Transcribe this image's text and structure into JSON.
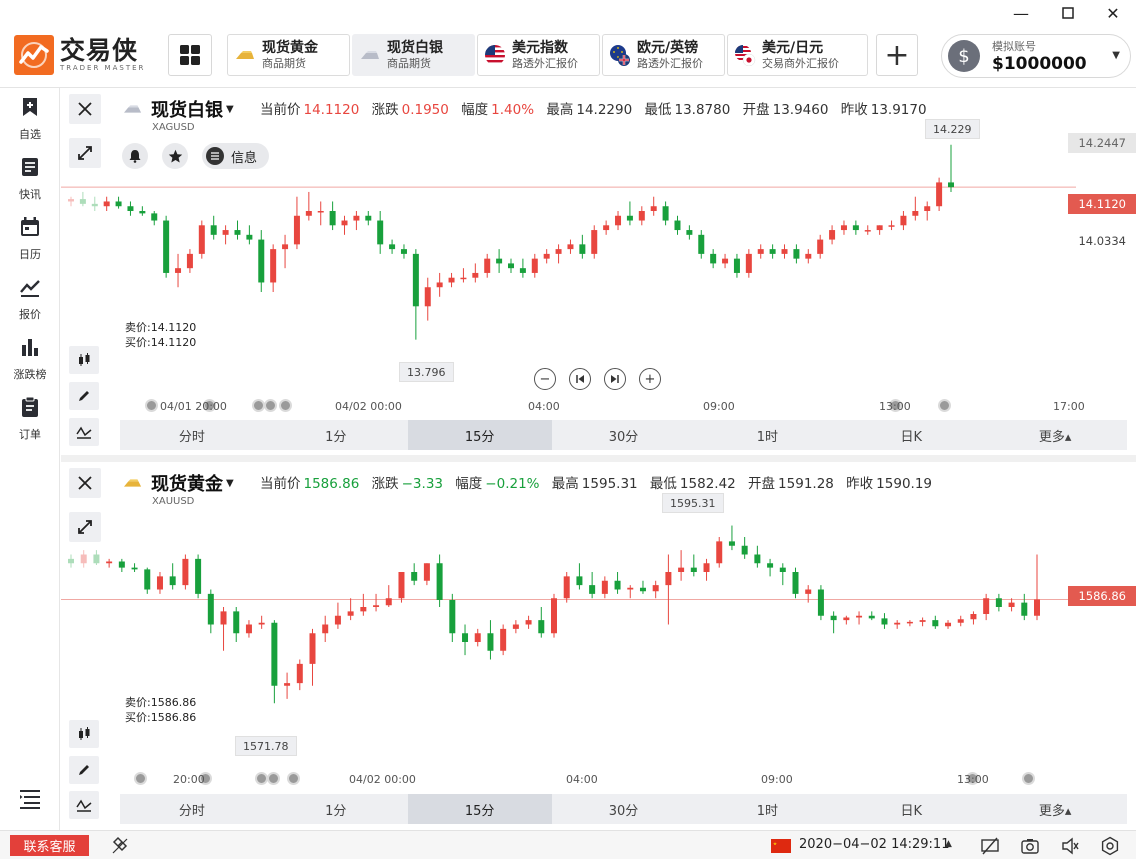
{
  "app": {
    "logo_cn": "交易侠",
    "logo_en": "TRADER MASTER",
    "colors": {
      "accent": "#f26b21",
      "up": "#e8463f",
      "down": "#18a03c",
      "tab_active": "#d8dbe1"
    }
  },
  "quote_tabs": [
    {
      "name": "现货黄金",
      "sub": "商品期货",
      "icon": "gold-bar-icon"
    },
    {
      "name": "现货白银",
      "sub": "商品期货",
      "icon": "silver-bar-icon"
    },
    {
      "name": "美元指数",
      "sub": "路透外汇报价",
      "icon": "us-flag-icon"
    },
    {
      "name": "欧元/英镑",
      "sub": "路透外汇报价",
      "icon": "eu-uk-flag-icon"
    },
    {
      "name": "美元/日元",
      "sub": "交易商外汇报价",
      "icon": "us-jp-flag-icon"
    }
  ],
  "account": {
    "label": "模拟账号",
    "balance": "$1000000"
  },
  "sidebar": [
    {
      "label": "自选",
      "icon": "bookmark-plus-icon"
    },
    {
      "label": "快讯",
      "icon": "news-icon"
    },
    {
      "label": "日历",
      "icon": "calendar-icon"
    },
    {
      "label": "报价",
      "icon": "line-chart-icon"
    },
    {
      "label": "涨跌榜",
      "icon": "bar-chart-icon"
    },
    {
      "label": "订单",
      "icon": "clipboard-icon"
    }
  ],
  "timeframes": [
    "分时",
    "1分",
    "15分",
    "30分",
    "1时",
    "日K",
    "更多▴"
  ],
  "panels": {
    "silver": {
      "name": "现货白银",
      "code": "XAGUSD",
      "stats": {
        "cur_label": "当前价",
        "cur": "14.1120",
        "chg_label": "涨跌",
        "chg": "0.1950",
        "pct_label": "幅度",
        "pct": "1.40%",
        "high_label": "最高",
        "high": "14.2290",
        "low_label": "最低",
        "low": "13.8780",
        "open_label": "开盘",
        "open": "13.9460",
        "prev_label": "昨收",
        "prev": "13.9170"
      },
      "info_label": "信息",
      "sell": "卖价:14.1120",
      "buy": "买价:14.1120",
      "price_tag": "14.1120",
      "side_top": "14.2447",
      "side_mid": "14.0334",
      "hi_callout": "14.229",
      "lo_callout": "13.796",
      "time_axis": [
        "04/01 20:00",
        "04/02 00:00",
        "04:00",
        "09:00",
        "13:00",
        "17:00"
      ]
    },
    "gold": {
      "name": "现货黄金",
      "code": "XAUUSD",
      "stats": {
        "cur_label": "当前价",
        "cur": "1586.86",
        "chg_label": "涨跌",
        "chg": "−3.33",
        "pct_label": "幅度",
        "pct": "−0.21%",
        "high_label": "最高",
        "high": "1595.31",
        "low_label": "最低",
        "low": "1582.42",
        "open_label": "开盘",
        "open": "1591.28",
        "prev_label": "昨收",
        "prev": "1590.19"
      },
      "sell": "卖价:1586.86",
      "buy": "买价:1586.86",
      "price_tag": "1586.86",
      "hi_callout": "1595.31",
      "lo_callout": "1571.78",
      "time_axis": [
        "20:00",
        "04/02 00:00",
        "04:00",
        "09:00",
        "13:00"
      ]
    }
  },
  "status": {
    "customer_service": "联系客服",
    "datetime": "2020−04−02 14:29:11"
  },
  "chart_data": [
    {
      "type": "candlestick",
      "title": "现货白银",
      "ylim": [
        13.75,
        14.26
      ],
      "candles": [
        [
          14.11,
          14.12,
          14.1,
          14.115
        ],
        [
          14.115,
          14.13,
          14.1,
          14.105
        ],
        [
          14.105,
          14.12,
          14.09,
          14.1
        ],
        [
          14.1,
          14.12,
          14.09,
          14.11
        ],
        [
          14.11,
          14.12,
          14.095,
          14.1
        ],
        [
          14.1,
          14.11,
          14.08,
          14.09
        ],
        [
          14.09,
          14.1,
          14.08,
          14.085
        ],
        [
          14.085,
          14.09,
          14.06,
          14.07
        ],
        [
          14.07,
          14.08,
          13.95,
          13.96
        ],
        [
          13.96,
          14.0,
          13.93,
          13.97
        ],
        [
          13.97,
          14.01,
          13.96,
          14.0
        ],
        [
          14.0,
          14.07,
          13.99,
          14.06
        ],
        [
          14.06,
          14.08,
          14.03,
          14.04
        ],
        [
          14.04,
          14.06,
          14.02,
          14.05
        ],
        [
          14.05,
          14.07,
          14.03,
          14.04
        ],
        [
          14.04,
          14.06,
          14.02,
          14.03
        ],
        [
          14.03,
          14.05,
          13.92,
          13.94
        ],
        [
          13.94,
          14.02,
          13.92,
          14.01
        ],
        [
          14.01,
          14.04,
          13.97,
          14.02
        ],
        [
          14.02,
          14.12,
          14.01,
          14.08
        ],
        [
          14.08,
          14.13,
          14.07,
          14.09
        ],
        [
          14.09,
          14.11,
          14.06,
          14.09
        ],
        [
          14.09,
          14.11,
          14.05,
          14.06
        ],
        [
          14.06,
          14.08,
          14.04,
          14.07
        ],
        [
          14.07,
          14.09,
          14.05,
          14.08
        ],
        [
          14.08,
          14.09,
          14.06,
          14.07
        ],
        [
          14.07,
          14.09,
          14.0,
          14.02
        ],
        [
          14.02,
          14.03,
          14.0,
          14.01
        ],
        [
          14.01,
          14.02,
          13.99,
          14.0
        ],
        [
          14.0,
          14.01,
          13.82,
          13.89
        ],
        [
          13.89,
          13.95,
          13.86,
          13.93
        ],
        [
          13.93,
          13.96,
          13.91,
          13.94
        ],
        [
          13.94,
          13.96,
          13.93,
          13.95
        ],
        [
          13.95,
          13.97,
          13.94,
          13.95
        ],
        [
          13.95,
          13.98,
          13.94,
          13.96
        ],
        [
          13.96,
          14.0,
          13.95,
          13.99
        ],
        [
          13.99,
          14.01,
          13.96,
          13.98
        ],
        [
          13.98,
          13.99,
          13.96,
          13.97
        ],
        [
          13.97,
          13.99,
          13.95,
          13.96
        ],
        [
          13.96,
          14.0,
          13.95,
          13.99
        ],
        [
          13.99,
          14.01,
          13.98,
          14.0
        ],
        [
          14.0,
          14.02,
          13.98,
          14.01
        ],
        [
          14.01,
          14.03,
          14.0,
          14.02
        ],
        [
          14.02,
          14.04,
          13.99,
          14.0
        ],
        [
          14.0,
          14.06,
          13.99,
          14.05
        ],
        [
          14.05,
          14.07,
          14.04,
          14.06
        ],
        [
          14.06,
          14.09,
          14.05,
          14.08
        ],
        [
          14.08,
          14.11,
          14.06,
          14.07
        ],
        [
          14.07,
          14.1,
          14.06,
          14.09
        ],
        [
          14.09,
          14.12,
          14.08,
          14.1
        ],
        [
          14.1,
          14.11,
          14.06,
          14.07
        ],
        [
          14.07,
          14.08,
          14.04,
          14.05
        ],
        [
          14.05,
          14.06,
          14.03,
          14.04
        ],
        [
          14.04,
          14.05,
          13.99,
          14.0
        ],
        [
          14.0,
          14.01,
          13.97,
          13.98
        ],
        [
          13.98,
          14.0,
          13.97,
          13.99
        ],
        [
          13.99,
          14.0,
          13.95,
          13.96
        ],
        [
          13.96,
          14.01,
          13.95,
          14.0
        ],
        [
          14.0,
          14.02,
          13.99,
          14.01
        ],
        [
          14.01,
          14.02,
          13.99,
          14.0
        ],
        [
          14.0,
          14.02,
          13.99,
          14.01
        ],
        [
          14.01,
          14.02,
          13.98,
          13.99
        ],
        [
          13.99,
          14.01,
          13.98,
          14.0
        ],
        [
          14.0,
          14.04,
          13.99,
          14.03
        ],
        [
          14.03,
          14.06,
          14.02,
          14.05
        ],
        [
          14.05,
          14.07,
          14.04,
          14.06
        ],
        [
          14.06,
          14.07,
          14.04,
          14.05
        ],
        [
          14.05,
          14.06,
          14.04,
          14.05
        ],
        [
          14.05,
          14.06,
          14.04,
          14.06
        ],
        [
          14.06,
          14.07,
          14.05,
          14.06
        ],
        [
          14.06,
          14.09,
          14.05,
          14.08
        ],
        [
          14.08,
          14.12,
          14.07,
          14.09
        ],
        [
          14.09,
          14.11,
          14.07,
          14.1
        ],
        [
          14.1,
          14.16,
          14.09,
          14.15
        ],
        [
          14.15,
          14.229,
          14.13,
          14.14
        ]
      ]
    },
    {
      "type": "candlestick",
      "title": "现货黄金",
      "ylim": [
        1570.0,
        1598.0
      ],
      "candles": [
        [
          1591.5,
          1592.0,
          1590.5,
          1591.0
        ],
        [
          1591.0,
          1592.5,
          1590.5,
          1592.0
        ],
        [
          1592.0,
          1592.5,
          1590.8,
          1591.0
        ],
        [
          1591.0,
          1591.5,
          1590.5,
          1591.2
        ],
        [
          1591.2,
          1591.5,
          1590.0,
          1590.5
        ],
        [
          1590.5,
          1591.0,
          1590.0,
          1590.3
        ],
        [
          1590.3,
          1590.5,
          1587.5,
          1588.0
        ],
        [
          1588.0,
          1590.0,
          1587.5,
          1589.5
        ],
        [
          1589.5,
          1591.0,
          1588.0,
          1588.5
        ],
        [
          1588.5,
          1592.0,
          1588.0,
          1591.5
        ],
        [
          1591.5,
          1592.0,
          1587.0,
          1587.5
        ],
        [
          1587.5,
          1588.0,
          1583.0,
          1584.0
        ],
        [
          1584.0,
          1586.0,
          1581.0,
          1585.5
        ],
        [
          1585.5,
          1586.0,
          1582.0,
          1583.0
        ],
        [
          1583.0,
          1584.5,
          1582.5,
          1584.0
        ],
        [
          1584.0,
          1585.0,
          1583.5,
          1584.2
        ],
        [
          1584.2,
          1584.5,
          1575.0,
          1577.0
        ],
        [
          1577.0,
          1578.5,
          1575.5,
          1577.3
        ],
        [
          1577.3,
          1580.0,
          1576.5,
          1579.5
        ],
        [
          1579.5,
          1583.5,
          1577.0,
          1583.0
        ],
        [
          1583.0,
          1585.0,
          1582.0,
          1584.0
        ],
        [
          1584.0,
          1586.5,
          1583.5,
          1585.0
        ],
        [
          1585.0,
          1587.0,
          1584.5,
          1585.5
        ],
        [
          1585.5,
          1587.5,
          1585.0,
          1586.0
        ],
        [
          1586.0,
          1587.5,
          1585.5,
          1586.2
        ],
        [
          1586.2,
          1588.5,
          1586.0,
          1587.0
        ],
        [
          1587.0,
          1589.5,
          1586.5,
          1590.0
        ],
        [
          1590.0,
          1591.0,
          1588.5,
          1589.0
        ],
        [
          1589.0,
          1591.0,
          1588.5,
          1591.0
        ],
        [
          1591.0,
          1592.0,
          1586.0,
          1586.8
        ],
        [
          1586.8,
          1587.5,
          1582.0,
          1583.0
        ],
        [
          1583.0,
          1584.0,
          1580.5,
          1582.0
        ],
        [
          1582.0,
          1583.5,
          1581.5,
          1583.0
        ],
        [
          1583.0,
          1584.5,
          1580.0,
          1581.0
        ],
        [
          1581.0,
          1584.0,
          1580.5,
          1583.5
        ],
        [
          1583.5,
          1584.5,
          1583.0,
          1584.0
        ],
        [
          1584.0,
          1585.0,
          1583.5,
          1584.5
        ],
        [
          1584.5,
          1586.0,
          1582.5,
          1583.0
        ],
        [
          1583.0,
          1587.5,
          1582.5,
          1587.0
        ],
        [
          1587.0,
          1590.0,
          1586.5,
          1589.5
        ],
        [
          1589.5,
          1591.0,
          1588.0,
          1588.5
        ],
        [
          1588.5,
          1590.0,
          1587.0,
          1587.5
        ],
        [
          1587.5,
          1589.5,
          1587.0,
          1589.0
        ],
        [
          1589.0,
          1590.0,
          1587.5,
          1588.0
        ],
        [
          1588.0,
          1588.5,
          1587.0,
          1588.2
        ],
        [
          1588.2,
          1589.0,
          1587.5,
          1587.8
        ],
        [
          1587.8,
          1589.0,
          1587.0,
          1588.5
        ],
        [
          1588.5,
          1592.0,
          1584.0,
          1590.0
        ],
        [
          1590.0,
          1592.5,
          1589.0,
          1590.5
        ],
        [
          1590.5,
          1592.0,
          1589.5,
          1590.0
        ],
        [
          1590.0,
          1591.5,
          1589.0,
          1591.0
        ],
        [
          1591.0,
          1594.0,
          1590.5,
          1593.5
        ],
        [
          1593.5,
          1595.31,
          1592.5,
          1593.0
        ],
        [
          1593.0,
          1594.0,
          1591.5,
          1592.0
        ],
        [
          1592.0,
          1593.0,
          1590.5,
          1591.0
        ],
        [
          1591.0,
          1591.5,
          1589.5,
          1590.5
        ],
        [
          1590.5,
          1591.0,
          1588.5,
          1590.0
        ],
        [
          1590.0,
          1590.5,
          1587.0,
          1587.5
        ],
        [
          1587.5,
          1588.5,
          1586.5,
          1588.0
        ],
        [
          1588.0,
          1588.5,
          1584.5,
          1585.0
        ],
        [
          1585.0,
          1585.5,
          1583.0,
          1584.5
        ],
        [
          1584.5,
          1585.0,
          1584.0,
          1584.8
        ],
        [
          1584.8,
          1585.5,
          1584.0,
          1585.0
        ],
        [
          1585.0,
          1585.5,
          1584.5,
          1584.7
        ],
        [
          1584.7,
          1585.3,
          1583.5,
          1584.0
        ],
        [
          1584.0,
          1584.5,
          1583.5,
          1584.2
        ],
        [
          1584.2,
          1584.5,
          1583.8,
          1584.3
        ],
        [
          1584.3,
          1584.8,
          1583.8,
          1584.5
        ],
        [
          1584.5,
          1585.0,
          1583.5,
          1583.8
        ],
        [
          1583.8,
          1584.5,
          1583.5,
          1584.2
        ],
        [
          1584.2,
          1585.0,
          1583.8,
          1584.6
        ],
        [
          1584.6,
          1585.5,
          1584.0,
          1585.2
        ],
        [
          1585.2,
          1587.5,
          1584.5,
          1587.0
        ],
        [
          1587.0,
          1587.5,
          1585.5,
          1586.0
        ],
        [
          1586.0,
          1587.0,
          1585.5,
          1586.5
        ],
        [
          1586.5,
          1587.5,
          1584.5,
          1585.0
        ],
        [
          1585.0,
          1592.0,
          1584.5,
          1586.86
        ]
      ]
    }
  ]
}
